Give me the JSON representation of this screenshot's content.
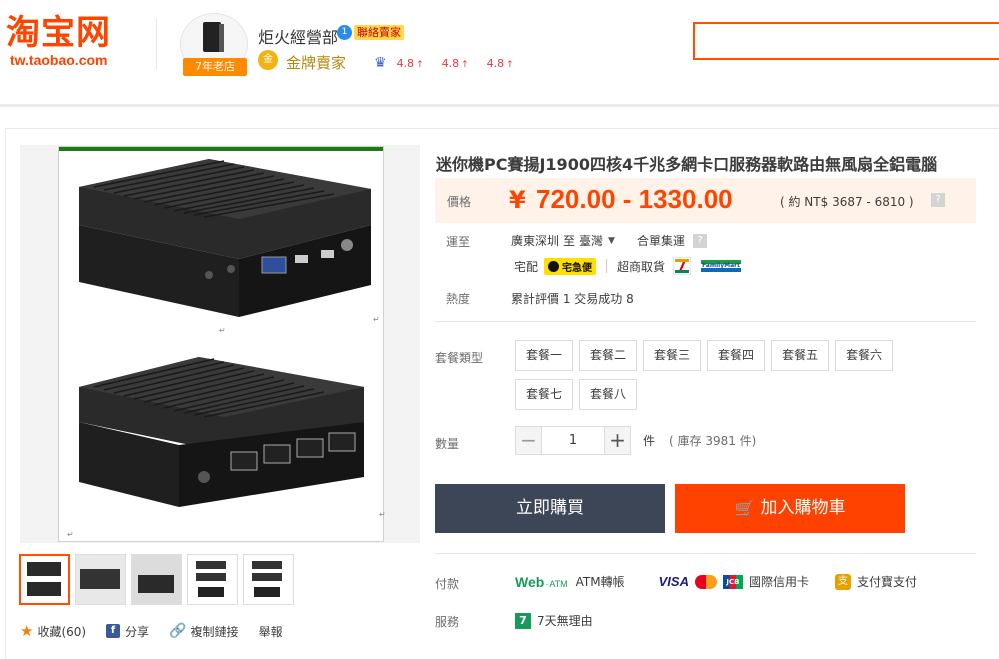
{
  "header": {
    "logo_cn": "淘宝网",
    "logo_url": "tw.taobao.com",
    "shop_name": "炬火經營部",
    "contact_badge_number": "1",
    "contact_badge_label": "聯絡賣家",
    "years_badge": "7年老店",
    "gold_icon_text": "金",
    "gold_seller": "金牌賣家",
    "ratings": [
      "4.8",
      "4.8",
      "4.8"
    ],
    "search_placeholder": ""
  },
  "product": {
    "title": "迷你機PC賽揚J1900四核4千兆多網卡口服務器軟路由無風扇全鋁電腦",
    "price_label": "價格",
    "price_currency": "¥",
    "price_range": "720.00 - 1330.00",
    "price_ntd": "( 約 NT$ 3687 - 6810 )",
    "ship_label": "運至",
    "ship_from": "廣東深圳",
    "ship_to_word": "至",
    "ship_to": "臺灣",
    "ship_method": "合單集運",
    "delivery_home": "宅配",
    "delivery_kuroneko": "宅急便",
    "delivery_store": "超商取貨",
    "famima_text": "FamilyMart",
    "sales_label": "熱度",
    "sales_text": "累計評價 1  交易成功 8",
    "package_label": "套餐類型",
    "packages": [
      "套餐一",
      "套餐二",
      "套餐三",
      "套餐四",
      "套餐五",
      "套餐六",
      "套餐七",
      "套餐八"
    ],
    "qty_label": "數量",
    "qty_value": "1",
    "qty_unit": "件",
    "qty_stock": "( 庫存 3981 件)",
    "buy_now": "立即購買",
    "add_cart": "加入購物車",
    "pay_label": "付款",
    "pay_webatm": "Web",
    "pay_webatm_small": "ATM",
    "pay_atm_transfer": "ATM轉帳",
    "pay_visa": "VISA",
    "pay_credit": "國際信用卡",
    "pay_alipay": "支付寶支付",
    "service_label": "服務",
    "service_7day": "7天無理由"
  },
  "social": {
    "favorite": "收藏(60)",
    "share": "分享",
    "copy_link": "複制鏈接",
    "report": "舉報"
  },
  "colors": {
    "brand": "#ff4400",
    "buy_button": "#3d4657",
    "cart_button": "#ff4200",
    "price_bg": "#fff2e8"
  }
}
